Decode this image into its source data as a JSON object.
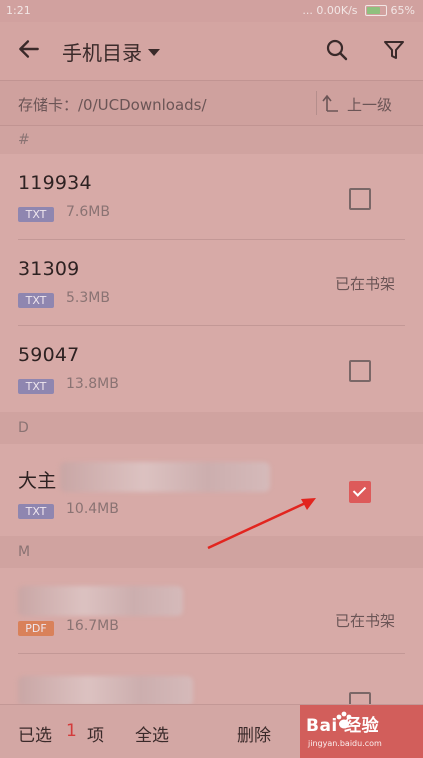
{
  "status": {
    "time": "1:21",
    "network": "... 0.00K/s",
    "battery": "65%"
  },
  "appbar": {
    "title": "手机目录"
  },
  "pathbar": {
    "path": "存储卡：/0/UCDownloads/",
    "up_label": "上一级"
  },
  "sections": {
    "hash": "#",
    "d": "D",
    "m": "M"
  },
  "items": [
    {
      "name": "119934",
      "type": "TXT",
      "size": "7.6MB",
      "state": "checkbox"
    },
    {
      "name": "31309",
      "type": "TXT",
      "size": "5.3MB",
      "state": "已在书架"
    },
    {
      "name": "59047",
      "type": "TXT",
      "size": "13.8MB",
      "state": "checkbox"
    },
    {
      "name": "大主",
      "type": "TXT",
      "size": "10.4MB",
      "state": "checked"
    },
    {
      "name": "",
      "type": "PDF",
      "size": "16.7MB",
      "state": "已在书架"
    },
    {
      "name": "",
      "type": "",
      "size": "",
      "state": "checkbox"
    }
  ],
  "bottombar": {
    "selected_label": "已选",
    "selected_count": "1",
    "selected_unit": "项",
    "select_all": "全选",
    "delete": "删除"
  },
  "watermark": {
    "main": "Bai  经验",
    "sub": "jingyan.baidu.com"
  },
  "colors": {
    "accent": "#dd5a5a",
    "txt_badge": "#8f86b0",
    "pdf_badge": "#d9815a"
  }
}
